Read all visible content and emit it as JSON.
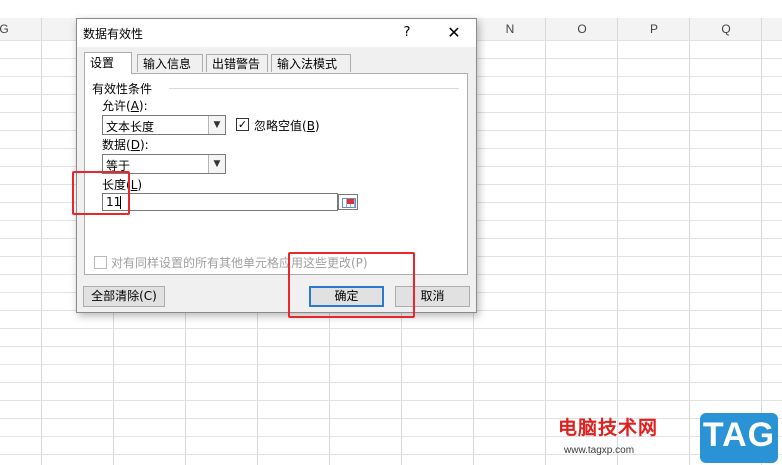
{
  "sheet": {
    "columns": [
      "G",
      "N",
      "O",
      "P",
      "Q"
    ]
  },
  "dialog": {
    "title": "数据有效性",
    "help_label": "?",
    "close_label": "✕",
    "tabs": [
      {
        "label": "设置",
        "active": true
      },
      {
        "label": "输入信息",
        "active": false
      },
      {
        "label": "出错警告",
        "active": false
      },
      {
        "label": "输入法模式",
        "active": false
      }
    ],
    "validity": {
      "group_label": "有效性条件",
      "allow_label_pre": "允许(",
      "allow_label_key": "A",
      "allow_label_post": "):",
      "allow_value": "文本长度",
      "ignore_blank_pre": "忽略空值(",
      "ignore_blank_key": "B",
      "ignore_blank_post": ")",
      "ignore_blank_checked": true,
      "data_label_pre": "数据(",
      "data_label_key": "D",
      "data_label_post": "):",
      "data_value": "等于",
      "length_label_pre": "长度(",
      "length_label_key": "L",
      "length_label_post": ")",
      "length_value": "11"
    },
    "apply_all_label": "对有同样设置的所有其他单元格应用这些更改(P)",
    "apply_all_checked": false,
    "clear_all_label": "全部清除(C)",
    "ok_label": "确定",
    "cancel_label": "取消"
  },
  "watermark": {
    "site_name": "电脑技术网",
    "url": "www.tagxp.com",
    "logo": "TAG"
  },
  "colors": {
    "highlight": "#e8262b",
    "default_button_border": "#2b79d0",
    "watermark_red": "#e0201f",
    "logo_blue": "#2a93d5"
  }
}
